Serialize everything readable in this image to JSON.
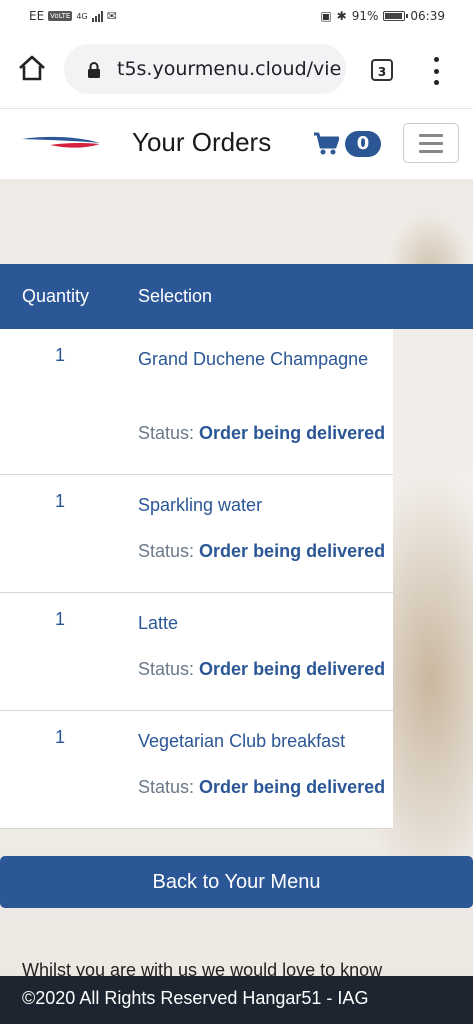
{
  "status_bar": {
    "carrier": "EE",
    "volte": "VoLTE",
    "network": "4G",
    "battery": "91%",
    "time": "06:39"
  },
  "browser": {
    "url": "t5s.yourmenu.cloud/vie",
    "tab_count": "3"
  },
  "header": {
    "title": "Your Orders",
    "cart_count": "0"
  },
  "table": {
    "columns": [
      "Quantity",
      "Selection"
    ],
    "status_label": "Status:",
    "rows": [
      {
        "quantity": "1",
        "selection": "Grand Duchene Champagne",
        "status": "Order being delivered"
      },
      {
        "quantity": "1",
        "selection": "Sparkling water",
        "status": "Order being delivered"
      },
      {
        "quantity": "1",
        "selection": "Latte",
        "status": "Order being delivered"
      },
      {
        "quantity": "1",
        "selection": "Vegetarian Club breakfast",
        "status": "Order being delivered"
      }
    ]
  },
  "back_button": "Back to Your Menu",
  "teaser_text": "Whilst you are with us we would love to know",
  "footer": "©2020 All Rights Reserved Hangar51 - IAG",
  "colors": {
    "brand_blue": "#2b5796",
    "footer_dark": "#1c2530"
  }
}
